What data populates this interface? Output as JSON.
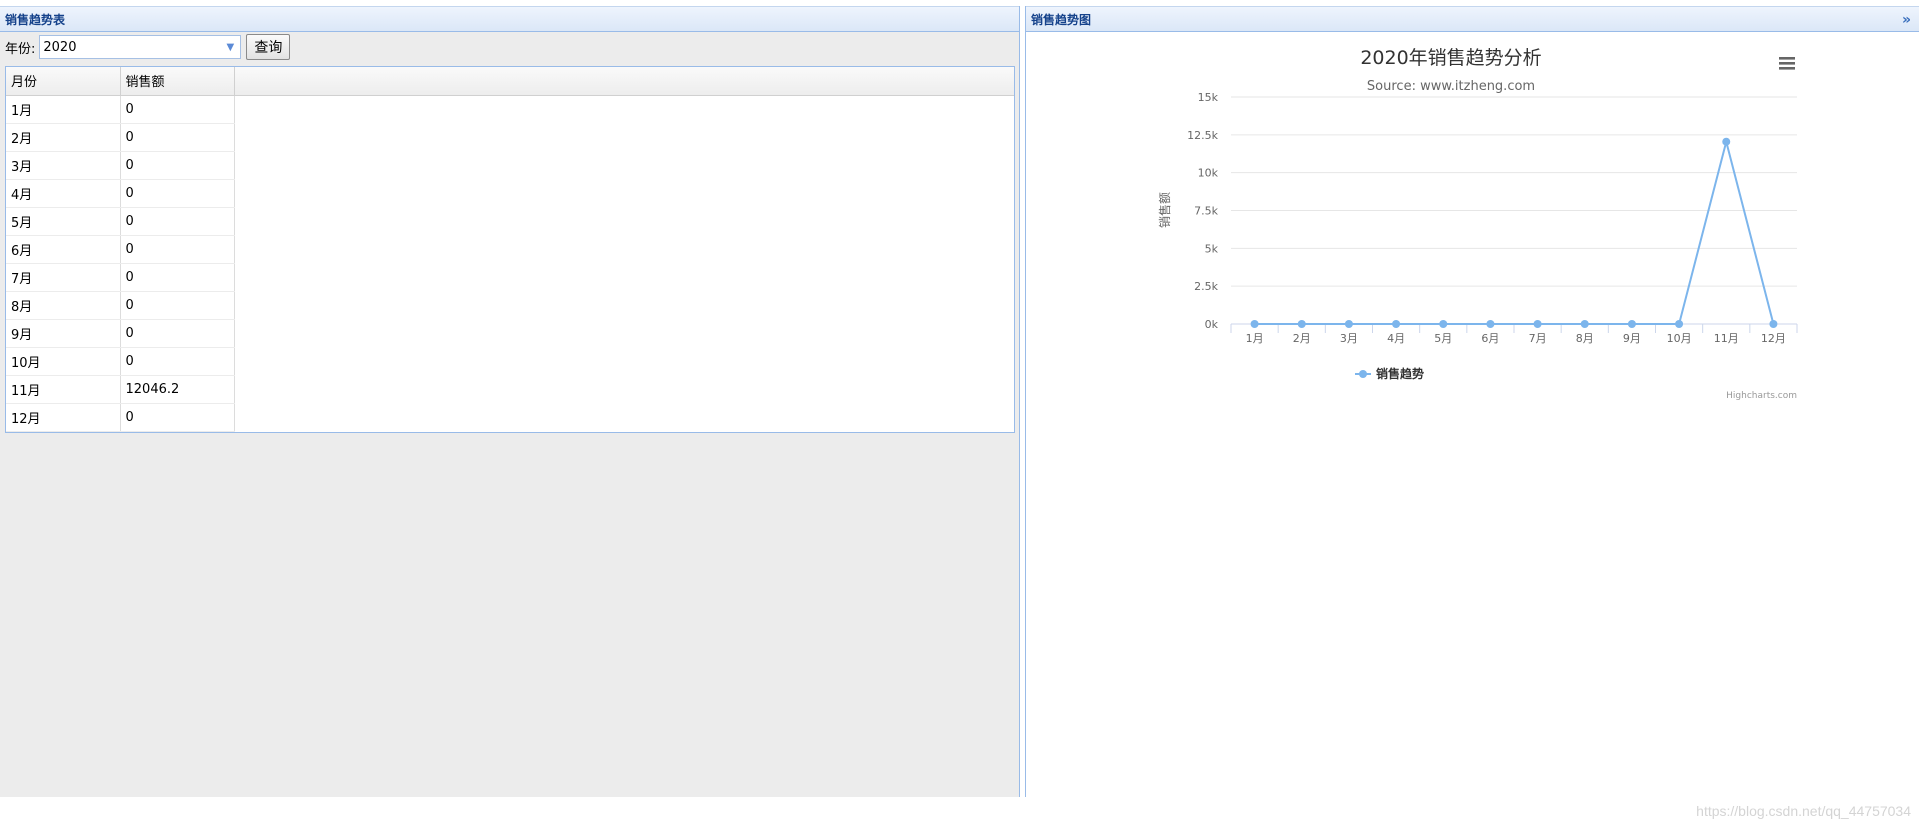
{
  "left_panel": {
    "title": "销售趋势表",
    "year_label": "年份:",
    "year_value": "2020",
    "query_label": "查询",
    "columns": [
      "月份",
      "销售额"
    ],
    "rows": [
      [
        "1月",
        "0"
      ],
      [
        "2月",
        "0"
      ],
      [
        "3月",
        "0"
      ],
      [
        "4月",
        "0"
      ],
      [
        "5月",
        "0"
      ],
      [
        "6月",
        "0"
      ],
      [
        "7月",
        "0"
      ],
      [
        "8月",
        "0"
      ],
      [
        "9月",
        "0"
      ],
      [
        "10月",
        "0"
      ],
      [
        "11月",
        "12046.2"
      ],
      [
        "12月",
        "0"
      ]
    ]
  },
  "right_panel": {
    "title": "销售趋势图",
    "collapse_icon": "double-chevron-right-icon",
    "menu_icon": "hamburger-menu-icon",
    "credits": "Highcharts.com"
  },
  "chart_data": {
    "type": "line",
    "title": "2020年销售趋势分析",
    "subtitle": "Source: www.itzheng.com",
    "xlabel": "",
    "ylabel": "销售额",
    "categories": [
      "1月",
      "2月",
      "3月",
      "4月",
      "5月",
      "6月",
      "7月",
      "8月",
      "9月",
      "10月",
      "11月",
      "12月"
    ],
    "series": [
      {
        "name": "销售趋势",
        "values": [
          0,
          0,
          0,
          0,
          0,
          0,
          0,
          0,
          0,
          0,
          12046.2,
          0
        ]
      }
    ],
    "ylim": [
      0,
      15000
    ],
    "yticks": [
      "0k",
      "2.5k",
      "5k",
      "7.5k",
      "10k",
      "12.5k",
      "15k"
    ],
    "grid": true,
    "legend_position": "bottom",
    "color": "#7cb5ec"
  },
  "watermark": "https://blog.csdn.net/qq_44757034"
}
